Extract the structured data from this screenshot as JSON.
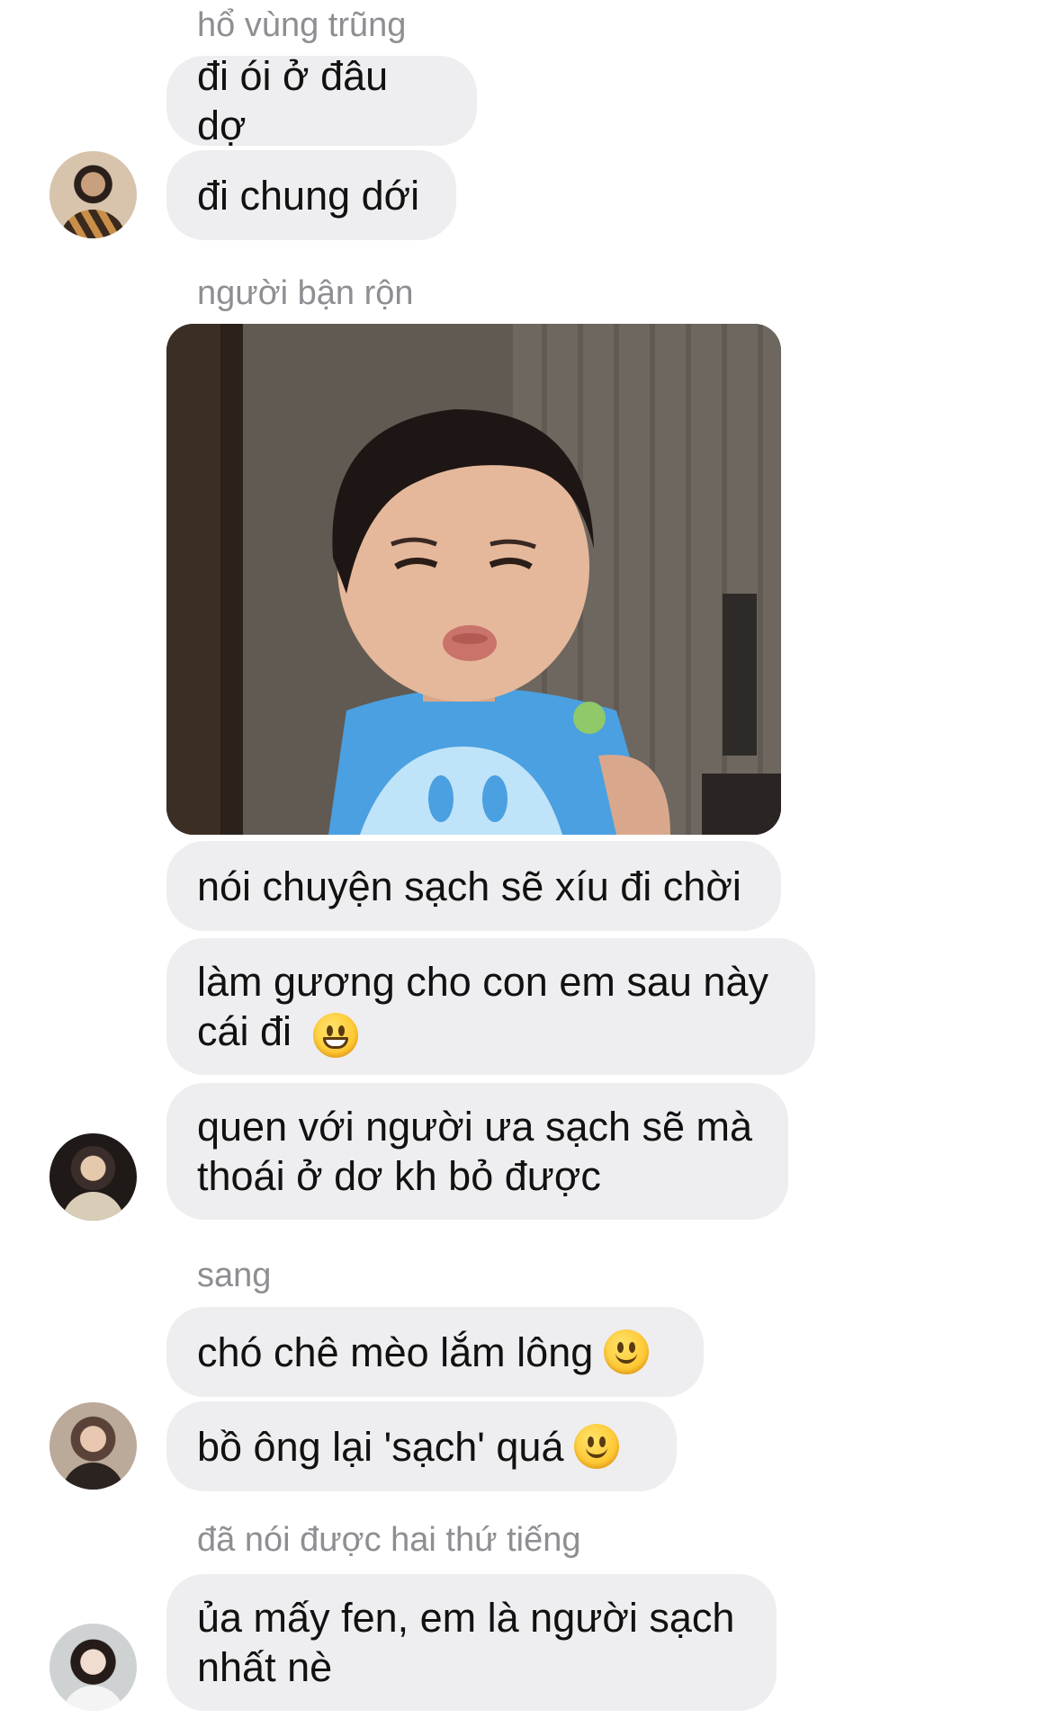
{
  "conversation": {
    "groups": [
      {
        "sender": "hổ vùng trũng",
        "messages": [
          {
            "text": "đi ói ở đâu dợ"
          },
          {
            "text": "đi chung dới"
          }
        ]
      },
      {
        "sender": "người bận rộn",
        "photo": {
          "description_icon": "photo-attachment"
        },
        "messages": [
          {
            "text": "nói chuyện sạch sẽ xíu đi chời"
          },
          {
            "text": "làm gương cho con em sau này\ncái đi",
            "emoji": "grinning-face-icon"
          },
          {
            "text": "quen với người ưa sạch sẽ mà\nthoái ở dơ kh bỏ được"
          }
        ]
      },
      {
        "sender": "sang",
        "messages": [
          {
            "text": "chó chê mèo lắm lông",
            "emoji": "slightly-smiling-face-icon"
          },
          {
            "text": "bồ ông lại 'sạch' quá",
            "emoji": "slightly-smiling-face-icon"
          }
        ]
      },
      {
        "sender": "đã nói được hai thứ tiếng",
        "messages": [
          {
            "text": "ủa mấy fen, em là người sạch\nnhất nè"
          }
        ]
      }
    ]
  },
  "colors": {
    "bubble_bg": "#eeeef0",
    "sender_text": "#8e8e93",
    "message_text": "#111111",
    "background": "#ffffff"
  }
}
